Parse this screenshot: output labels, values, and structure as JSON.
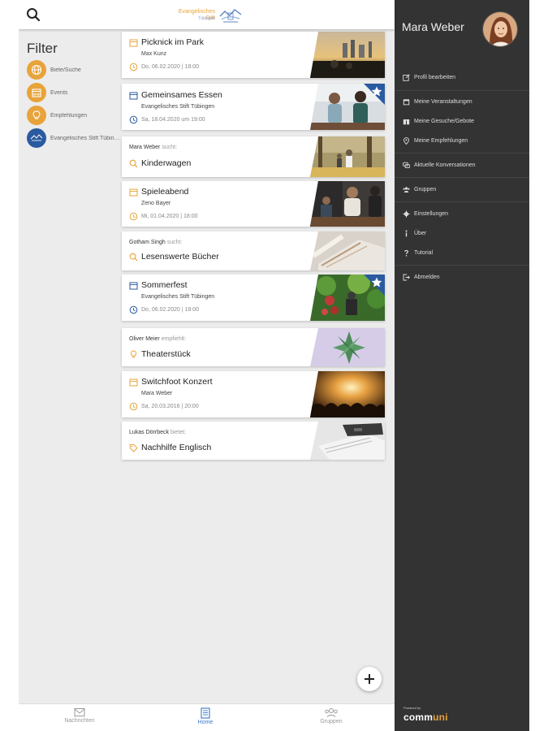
{
  "header": {
    "logo_line1": "Evangelisches Stift",
    "logo_line2": "Tübingen"
  },
  "filter": {
    "title": "Filter",
    "items": [
      {
        "label": "Biete/Suche",
        "icon": "globe-icon"
      },
      {
        "label": "Events",
        "icon": "calendar-icon"
      },
      {
        "label": "Empfehlungen",
        "icon": "lightbulb-icon"
      },
      {
        "label": "Evangelisches Stift Tübingen",
        "icon": "stift-logo-icon"
      }
    ]
  },
  "feed": {
    "cards": [
      {
        "kind": "event",
        "title": "Picknick im Park",
        "subtitle": "Max Kunz",
        "date": "Do, 06.02.2020 | 18:00",
        "starred": false
      },
      {
        "kind": "event",
        "title": "Gemeinsames Essen",
        "subtitle": "Evangelisches Stift Tübingen",
        "date": "Sa, 18.04.2020 um 19:00",
        "starred": true
      },
      {
        "kind": "post",
        "author": "Mara Weber",
        "verb": "sucht:",
        "title": "Kinderwagen",
        "icon": "search-icon"
      },
      {
        "kind": "event",
        "title": "Spieleabend",
        "subtitle": "Zeno Bayer",
        "date": "Mi, 01.04.2020 | 18:00",
        "starred": false
      },
      {
        "kind": "post",
        "author": "Gotham Singh",
        "verb": "sucht:",
        "title": "Lesenswerte Bücher",
        "icon": "search-icon"
      },
      {
        "kind": "event",
        "title": "Sommerfest",
        "subtitle": "Evangelisches Stift Tübingen",
        "date": "Do, 06.02.2020 | 18:00",
        "starred": true
      },
      {
        "kind": "post",
        "author": "Oliver Meier",
        "verb": "empfiehlt:",
        "title": "Theaterstück",
        "icon": "lightbulb-icon"
      },
      {
        "kind": "event",
        "title": "Switchfoot Konzert",
        "subtitle": "Mara Weber",
        "date": "Sa, 20.03.2016 | 20:00",
        "starred": false
      },
      {
        "kind": "post",
        "author": "Lukas Dörrbeck",
        "verb": "bietet:",
        "title": "Nachhilfe Englisch",
        "icon": "tag-icon"
      }
    ]
  },
  "bottom_nav": {
    "items": [
      {
        "label": "Nachrichten",
        "icon": "mail-icon",
        "active": false
      },
      {
        "label": "Home",
        "icon": "newspaper-icon",
        "active": true
      },
      {
        "label": "Gruppen",
        "icon": "group-icon",
        "active": false
      }
    ]
  },
  "drawer": {
    "user_name": "Mara Weber",
    "menu": [
      {
        "label": "Profil bearbeiten",
        "icon": "edit-icon"
      },
      {
        "label": "Meine Veranstaltungen",
        "icon": "calendar-icon"
      },
      {
        "label": "Meine Gesuche/Gebote",
        "icon": "gift-icon"
      },
      {
        "label": "Meine Empfehlungen",
        "icon": "pin-icon"
      },
      {
        "label": "Aktuelle Konversationen",
        "icon": "chat-icon"
      },
      {
        "label": "Gruppen",
        "icon": "group-icon"
      },
      {
        "label": "Einstellungen",
        "icon": "gear-icon"
      },
      {
        "label": "Über",
        "icon": "info-icon"
      },
      {
        "label": "Tutorial",
        "icon": "question-icon"
      },
      {
        "label": "Abmelden",
        "icon": "logout-icon"
      }
    ],
    "brand_small": "Powered by",
    "brand_name_a": "comm",
    "brand_name_b": "uni"
  },
  "colors": {
    "accent": "#e8a33a",
    "primary": "#2a5aa0",
    "drawer_bg": "#333333",
    "active_nav": "#3a78c8"
  }
}
